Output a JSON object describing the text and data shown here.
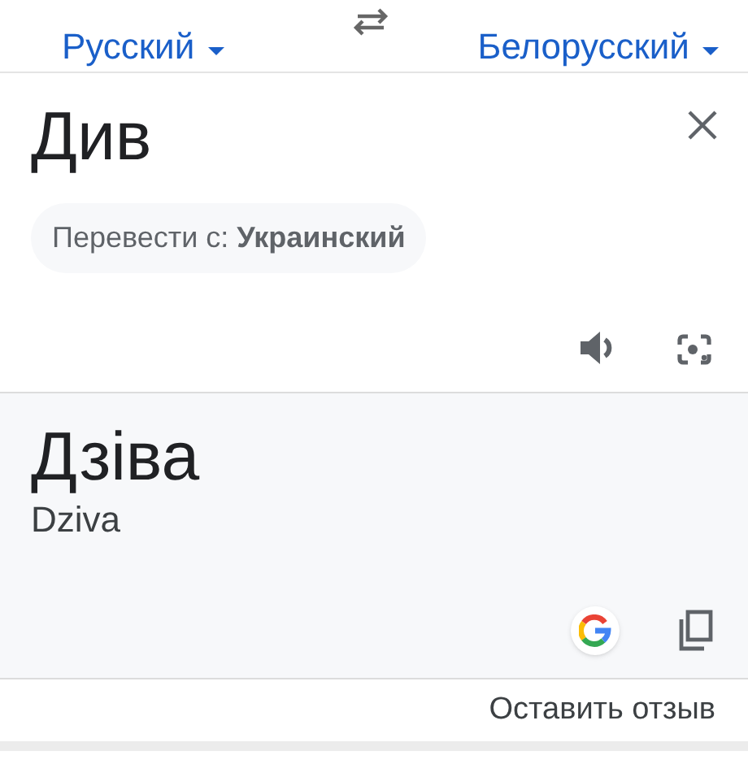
{
  "languages": {
    "source": "Русский",
    "target": "Белорусский"
  },
  "input": {
    "text": "Див",
    "suggestion": "Перевести с: **Украинский**"
  },
  "result": {
    "text": "Дзіва",
    "transliteration": "Dziva"
  },
  "feedback_link": "Оставить отзыв"
}
